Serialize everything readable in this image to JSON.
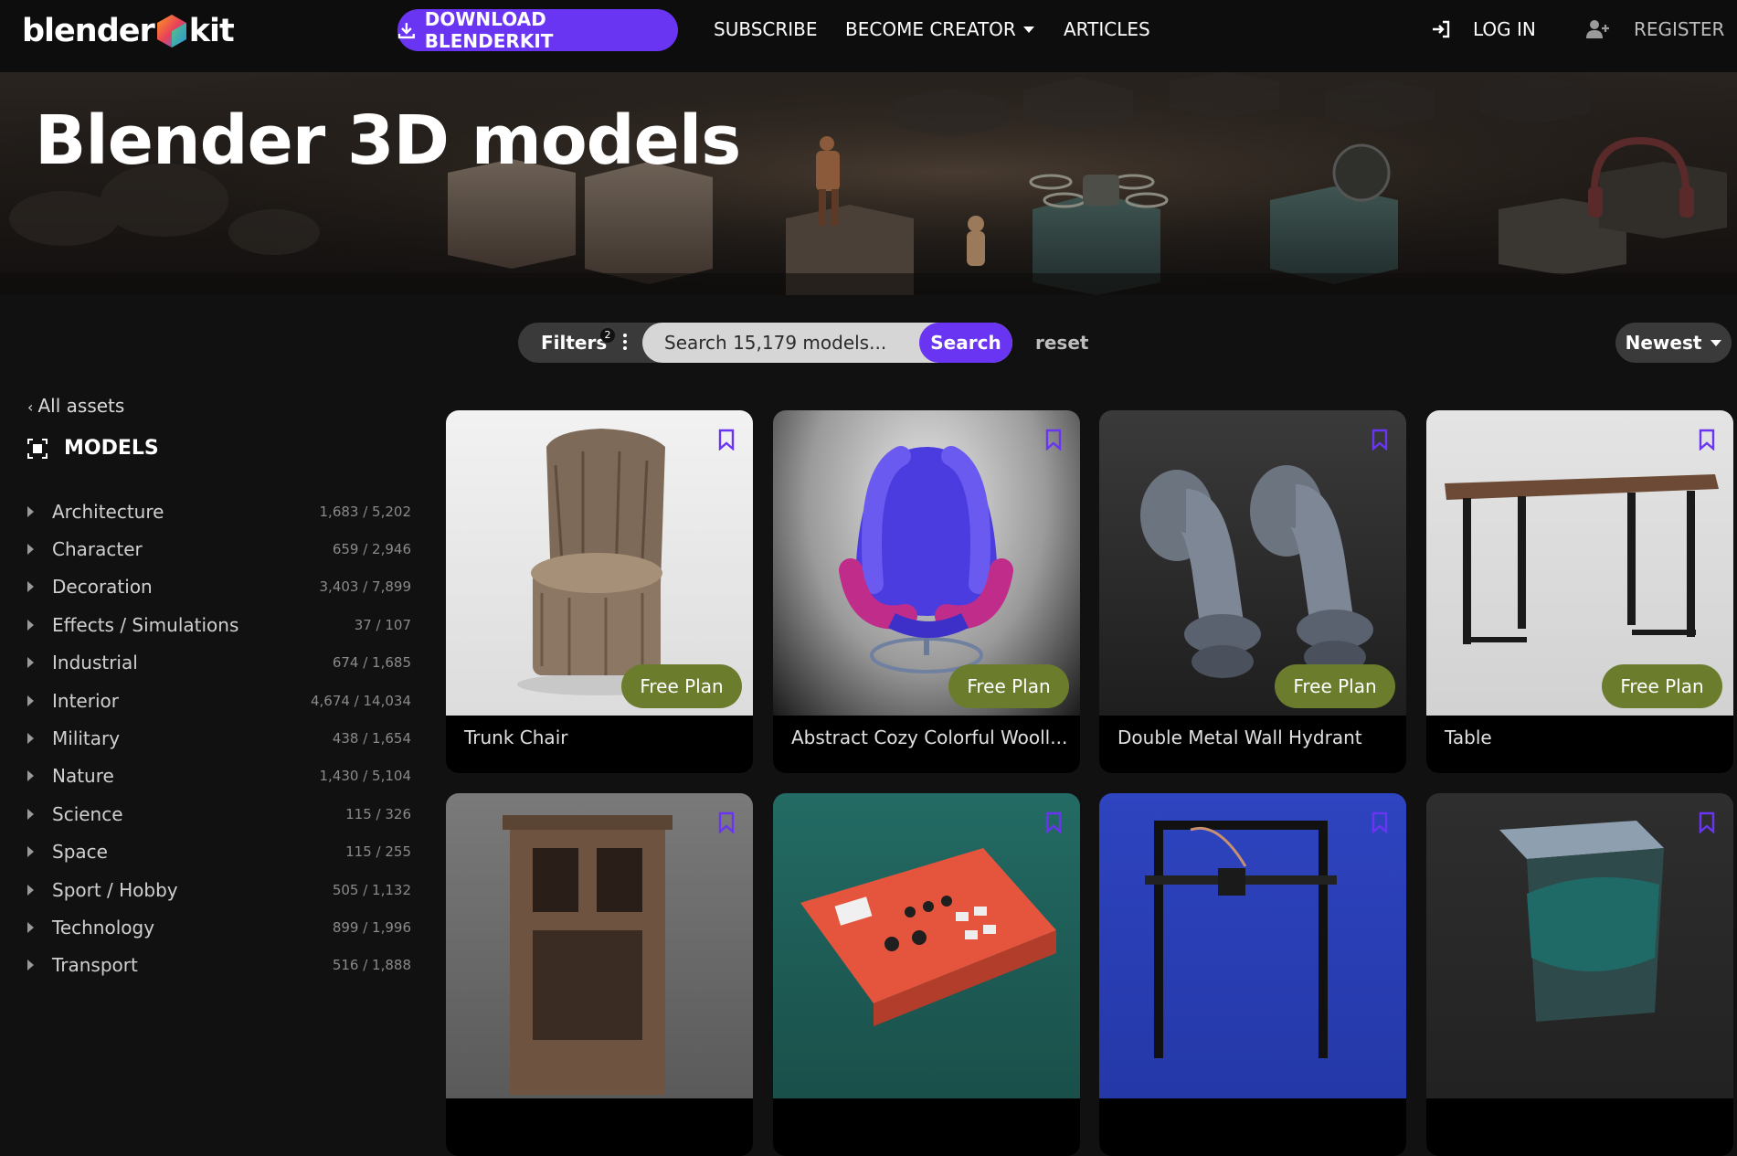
{
  "nav": {
    "logo_left": "blender",
    "logo_right": "kit",
    "download_label": "DOWNLOAD BLENDERKIT",
    "subscribe": "SUBSCRIBE",
    "become_creator": "BECOME CREATOR",
    "articles": "ARTICLES",
    "login": "LOG IN",
    "register": "REGISTER"
  },
  "hero": {
    "title": "Blender 3D models"
  },
  "searchbar": {
    "filters_label": "Filters",
    "filters_count": "2",
    "placeholder": "Search 15,179 models...",
    "search_label": "Search",
    "reset_label": "reset",
    "sort_label": "Newest"
  },
  "sidebar": {
    "back_label": "All assets",
    "section_title": "MODELS",
    "categories": [
      {
        "label": "Architecture",
        "count": "1,683 / 5,202"
      },
      {
        "label": "Character",
        "count": "659 / 2,946"
      },
      {
        "label": "Decoration",
        "count": "3,403 / 7,899"
      },
      {
        "label": "Effects / Simulations",
        "count": "37 / 107"
      },
      {
        "label": "Industrial",
        "count": "674 / 1,685"
      },
      {
        "label": "Interior",
        "count": "4,674 / 14,034"
      },
      {
        "label": "Military",
        "count": "438 / 1,654"
      },
      {
        "label": "Nature",
        "count": "1,430 / 5,104"
      },
      {
        "label": "Science",
        "count": "115 / 326"
      },
      {
        "label": "Space",
        "count": "115 / 255"
      },
      {
        "label": "Sport / Hobby",
        "count": "505 / 1,132"
      },
      {
        "label": "Technology",
        "count": "899 / 1,996"
      },
      {
        "label": "Transport",
        "count": "516 / 1,888"
      }
    ]
  },
  "cards": [
    {
      "title": "Trunk Chair",
      "plan": "Free Plan"
    },
    {
      "title": "Abstract Cozy Colorful Wooll...",
      "plan": "Free Plan"
    },
    {
      "title": "Double Metal Wall Hydrant",
      "plan": "Free Plan"
    },
    {
      "title": "Table",
      "plan": "Free Plan"
    }
  ],
  "colors": {
    "accent": "#6a34f3",
    "plan_badge": "#6b7d2d",
    "background": "#111111"
  }
}
